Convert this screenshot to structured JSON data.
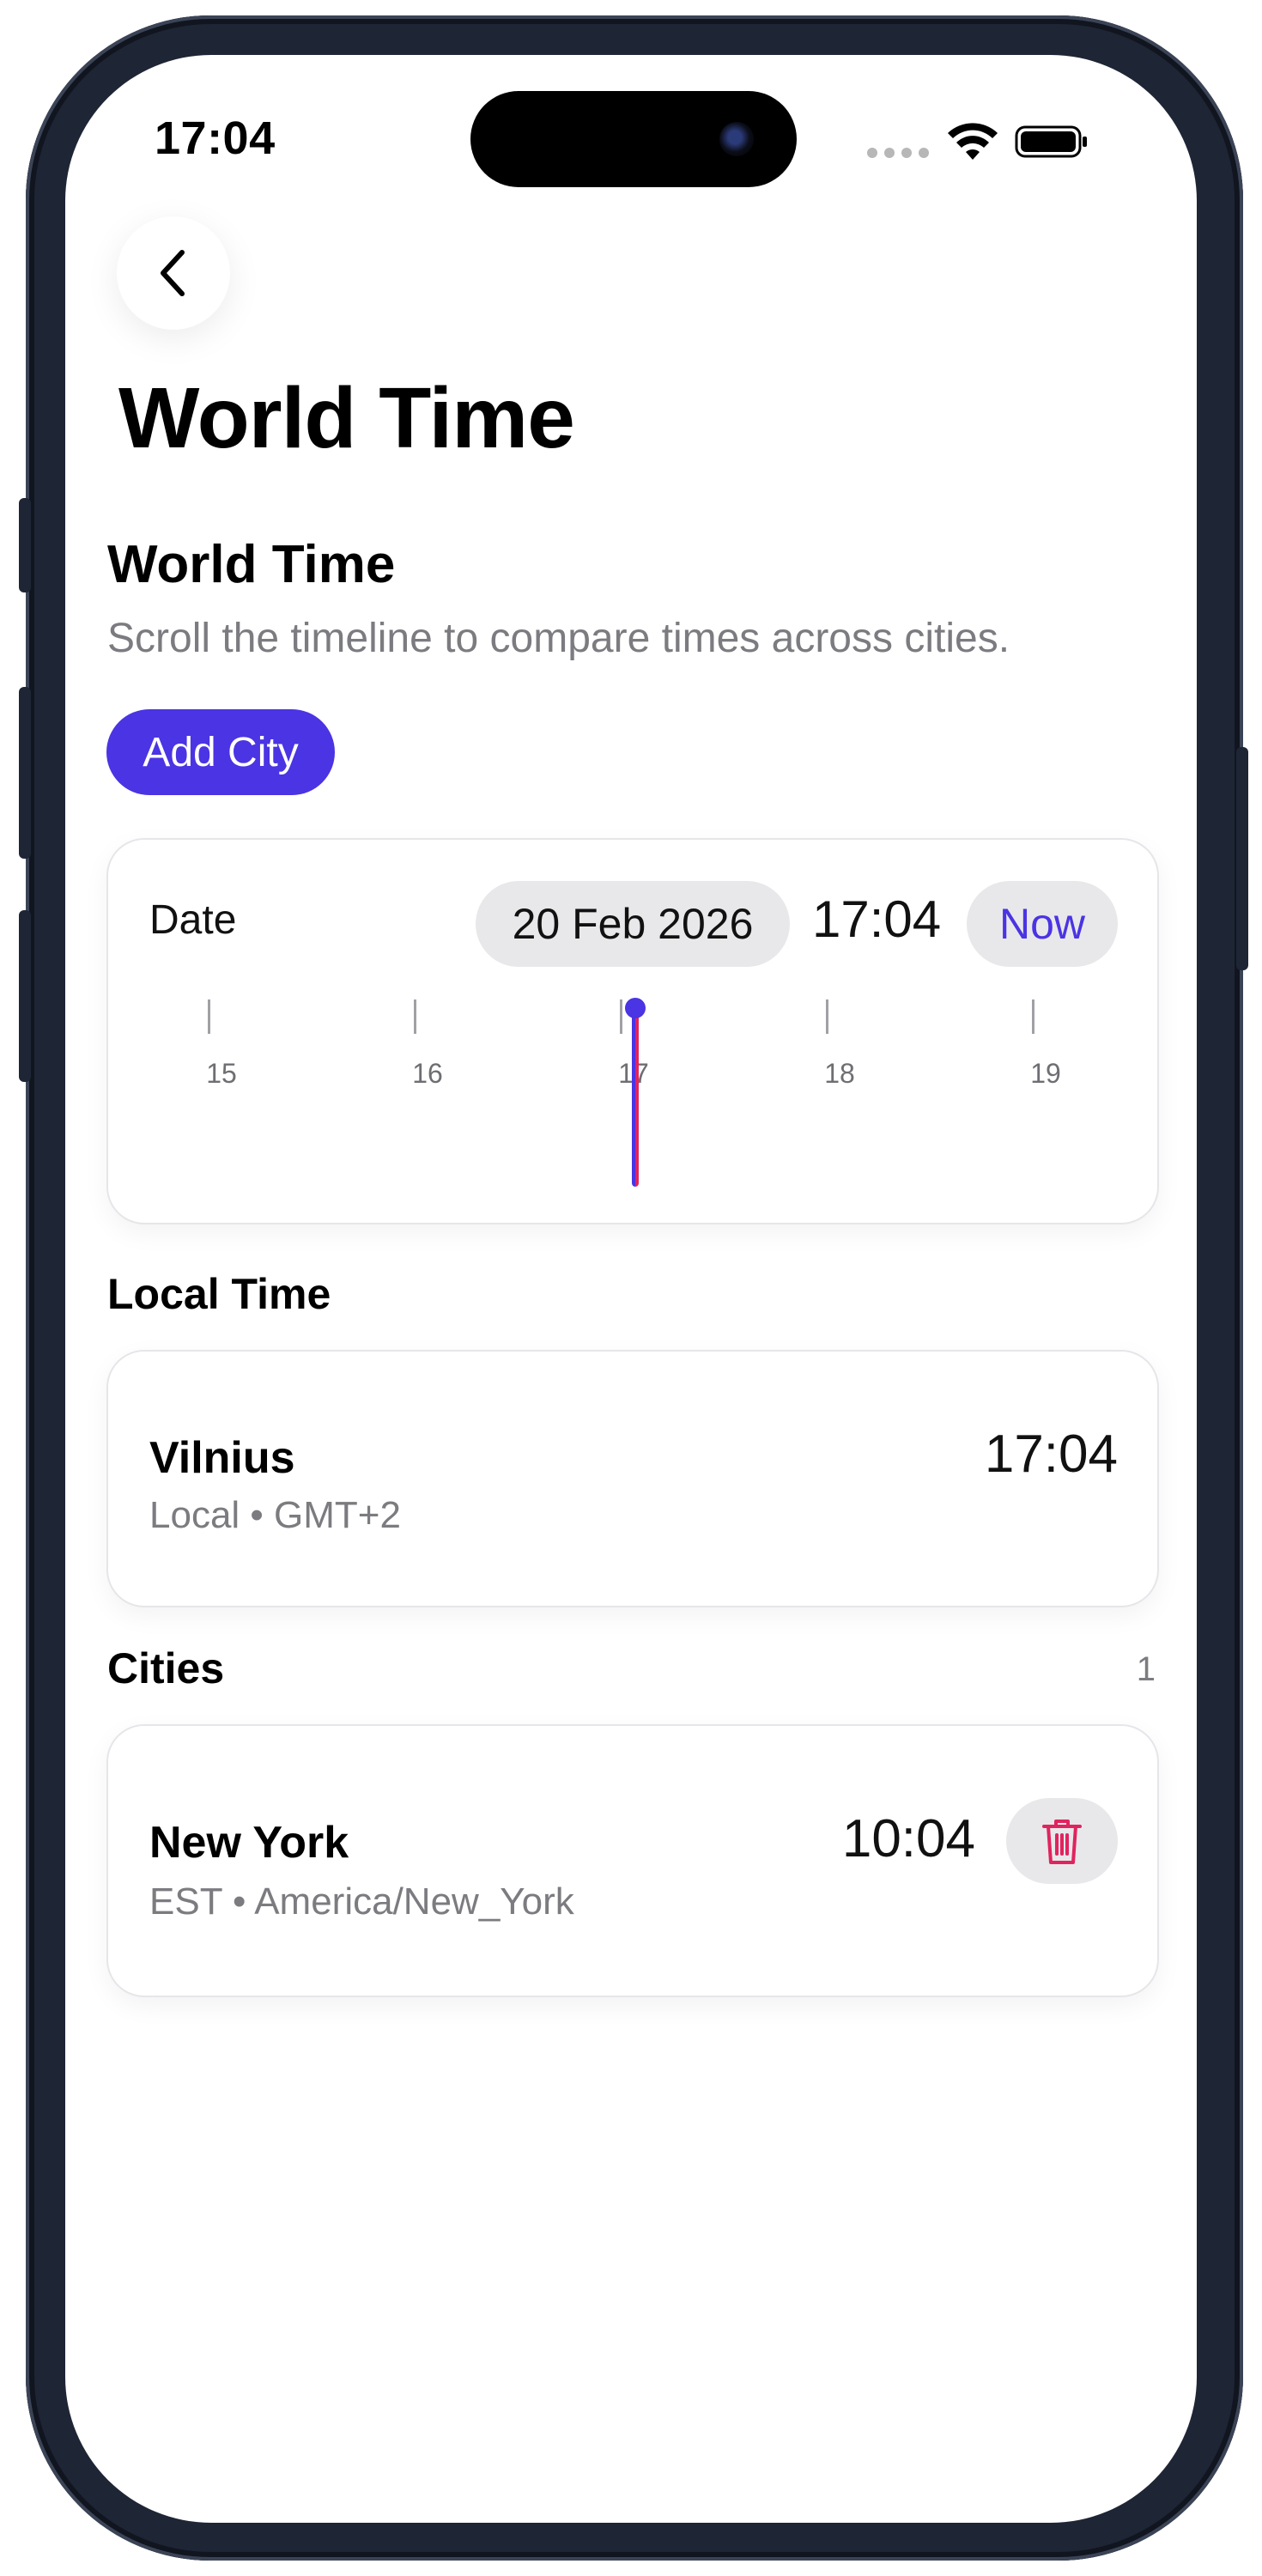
{
  "status_bar": {
    "time": "17:04",
    "icons": [
      "signal-dots-icon",
      "wifi-icon",
      "battery-icon"
    ]
  },
  "nav": {
    "back_icon": "chevron-left-icon",
    "page_title": "World Time"
  },
  "header": {
    "section_title": "World Time",
    "subtitle": "Scroll the timeline to compare times across cities.",
    "add_city_label": "Add City"
  },
  "timeline": {
    "date_label": "Date",
    "date_value": "20 Feb 2026",
    "time_value": "17:04",
    "now_label": "Now",
    "hour_ticks": [
      "15",
      "16",
      "17",
      "18",
      "19"
    ],
    "selected_hour": "17"
  },
  "local": {
    "section_label": "Local Time",
    "city": "Vilnius",
    "meta": "Local • GMT+2",
    "time": "17:04"
  },
  "cities": {
    "section_label": "Cities",
    "count": "1",
    "items": [
      {
        "name": "New York",
        "meta": "EST • America/New_York",
        "time": "10:04",
        "delete_icon": "trash-icon"
      }
    ]
  },
  "colors": {
    "accent": "#4a34e3",
    "danger": "#e0245e",
    "pill_bg": "#e8e8ea",
    "secondary_text": "#7b7b80"
  }
}
